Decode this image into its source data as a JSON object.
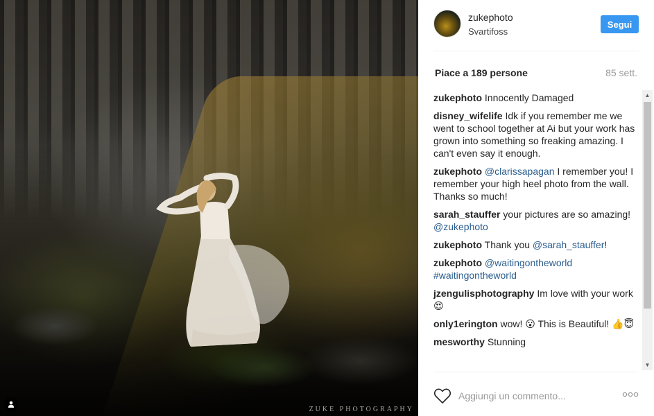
{
  "post": {
    "username": "zukephoto",
    "location": "Svartifoss",
    "follow_label": "Segui",
    "likes_text": "Piace a 189 persone",
    "time_ago": "85 sett.",
    "watermark": "ZUKE PHOTOGRAPHY",
    "add_comment_placeholder": "Aggiungi un commento...",
    "more_options_label": "ooo"
  },
  "comments": [
    {
      "user": "zukephoto",
      "parts": [
        "Innocently Damaged"
      ]
    },
    {
      "user": "disney_wifelife",
      "parts": [
        "Idk if you remember me we went to school together at Ai but your work has grown into something so freaking amazing. I can't even say it enough."
      ]
    },
    {
      "user": "zukephoto",
      "mention": "@clarissapagan",
      "parts": [
        "I remember you! I remember your high heel photo from the wall. Thanks so much!"
      ]
    },
    {
      "user": "sarah_stauffer",
      "parts": [
        "your pictures are so amazing!"
      ],
      "mention_end": "@zukephoto"
    },
    {
      "user": "zukephoto",
      "parts": [
        "Thank you"
      ],
      "mention_end": "@sarah_stauffer",
      "suffix": "!"
    },
    {
      "user": "zukephoto",
      "mention": "@waitingontheworld",
      "tag": "#waitingontheworld"
    },
    {
      "user": "jzengulisphotography",
      "parts": [
        "Im love with your work😍"
      ]
    },
    {
      "user": "only1erington",
      "parts": [
        "wow! 😮 This is Beautiful! 👍😇"
      ]
    },
    {
      "user": "mesworthy",
      "parts": [
        "Stunning"
      ]
    }
  ],
  "colors": {
    "follow_bg": "#3897f0",
    "mention": "#2a5d8f"
  },
  "icons": [
    "user-tag-icon",
    "heart-icon",
    "more-options-icon",
    "scroll-up-icon",
    "scroll-down-icon"
  ]
}
